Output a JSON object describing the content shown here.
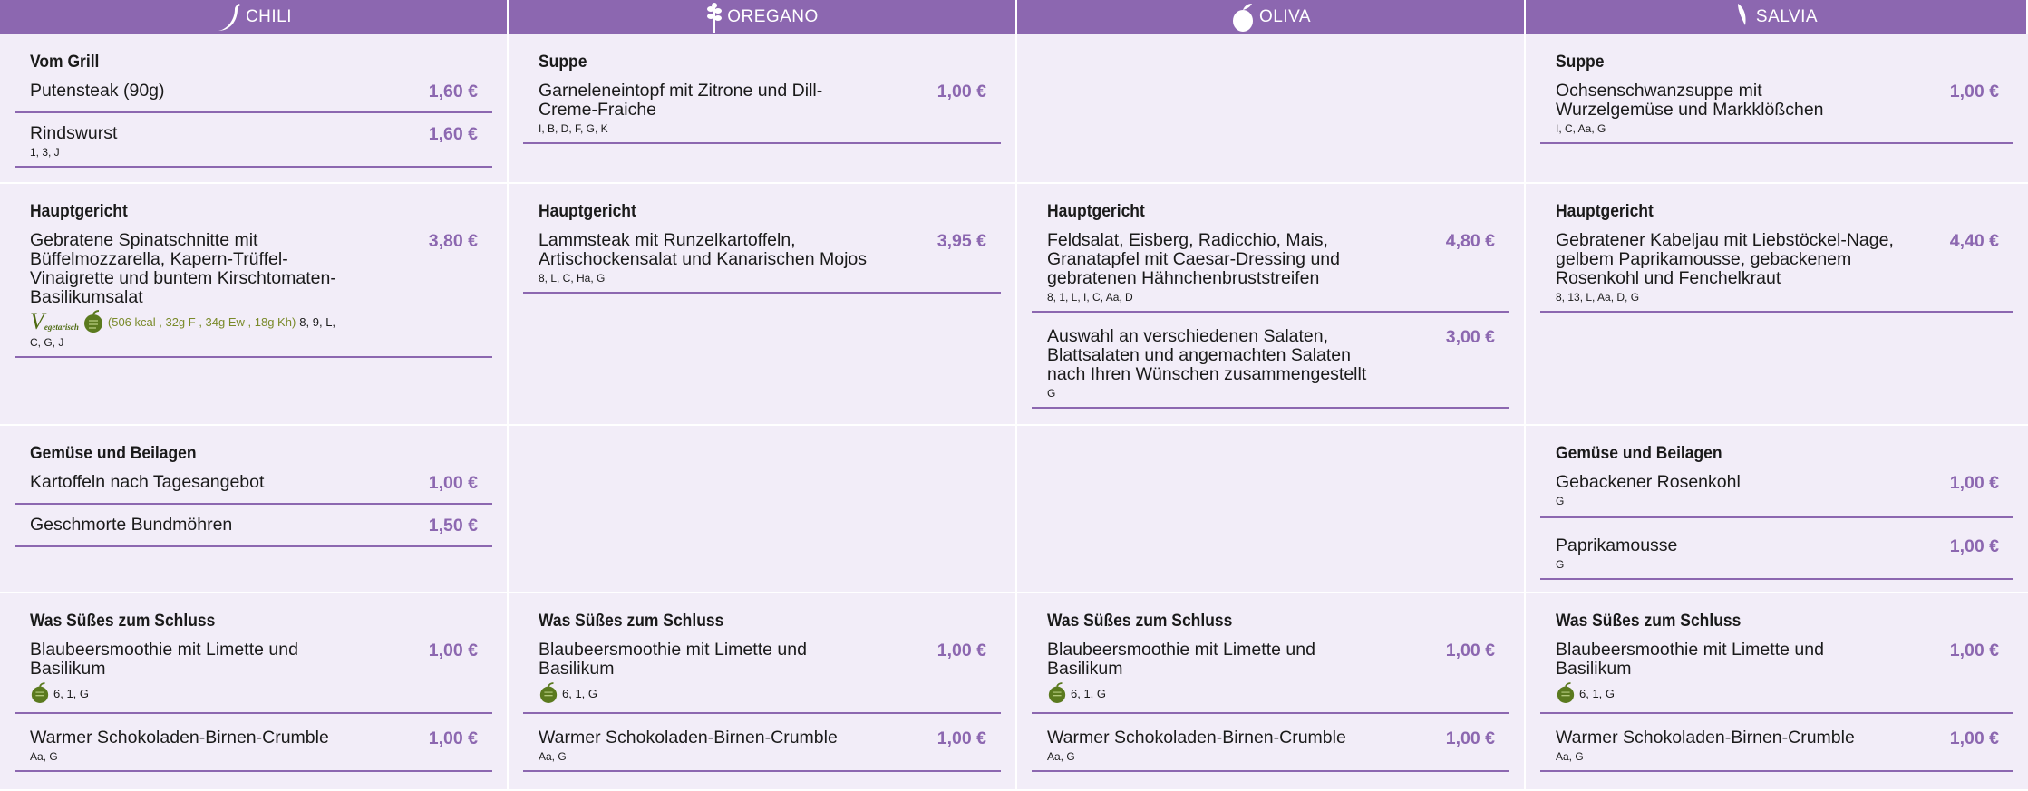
{
  "columns": [
    {
      "name": "CHILI",
      "icon": "chili-icon"
    },
    {
      "name": "OREGANO",
      "icon": "oregano-icon"
    },
    {
      "name": "OLIVA",
      "icon": "olive-icon"
    },
    {
      "name": "SALVIA",
      "icon": "sage-icon"
    }
  ],
  "colors": {
    "accent": "#8c67b0",
    "cell_bg": "#f2edf8",
    "price": "#8c67b0",
    "veg_green": "#4e6b12",
    "nutri": "#7a8a2a"
  },
  "rows": {
    "r1": {
      "chili": {
        "title": "Vom Grill",
        "items": [
          {
            "name": "Putensteak (90g)",
            "price": "1,60 €",
            "allergens": ""
          },
          {
            "name": "Rindswurst",
            "price": "1,60 €",
            "allergens": "1, 3, J"
          }
        ]
      },
      "oregano": {
        "title": "Suppe",
        "items": [
          {
            "name": "Garneleneintopf mit Zitrone und Dill-Creme-Fraiche",
            "price": "1,00 €",
            "allergens": "I, B, D, F, G, K"
          }
        ]
      },
      "salvia": {
        "title": "Suppe",
        "items": [
          {
            "name": "Ochsenschwanzsuppe mit Wurzelgemüse und Markklößchen",
            "price": "1,00 €",
            "allergens": "I, C, Aa, G"
          }
        ]
      }
    },
    "r2": {
      "chili": {
        "title": "Hauptgericht",
        "items": [
          {
            "name": "Gebratene Spinatschnitte mit Büffelmozzarella, Kapern-Trüffel-Vinaigrette und buntem Kirschtomaten-Basilikumsalat",
            "price": "3,80 €",
            "veg_big": "V",
            "veg_text": "egetarisch",
            "nutrition": "(506 kcal , 32g F , 34g Ew , 18g Kh)",
            "allergens_inline": "8, 9, L,",
            "allergens": "C, G, J"
          }
        ]
      },
      "oregano": {
        "title": "Hauptgericht",
        "items": [
          {
            "name": "Lammsteak mit Runzelkartoffeln, Artischockensalat und Kanarischen Mojos",
            "price": "3,95 €",
            "allergens": "8, L, C, Ha, G"
          }
        ]
      },
      "oliva": {
        "title": "Hauptgericht",
        "items": [
          {
            "name": "Feldsalat, Eisberg, Radicchio, Mais, Granatapfel mit Caesar-Dressing und gebratenen Hähnchenbruststreifen",
            "price": "4,80 €",
            "allergens": "8, 1, L, I, C, Aa, D"
          },
          {
            "name": "Auswahl an verschiedenen Salaten, Blattsalaten und angemachten Salaten nach Ihren Wünschen zusammengestellt",
            "price": "3,00 €",
            "allergens": "G"
          }
        ]
      },
      "salvia": {
        "title": "Hauptgericht",
        "items": [
          {
            "name": "Gebratener Kabeljau mit Liebstöckel-Nage, gelbem Paprikamousse, gebackenem Rosenkohl und Fenchelkraut",
            "price": "4,40 €",
            "allergens": "8, 13, L, Aa, D, G"
          }
        ]
      }
    },
    "r3": {
      "chili": {
        "title": "Gemüse und Beilagen",
        "items": [
          {
            "name": "Kartoffeln nach Tagesangebot",
            "price": "1,00 €",
            "allergens": ""
          },
          {
            "name": "Geschmorte Bundmöhren",
            "price": "1,50 €",
            "allergens": ""
          }
        ]
      },
      "salvia": {
        "title": "Gemüse und Beilagen",
        "items": [
          {
            "name": "Gebackener Rosenkohl",
            "price": "1,00 €",
            "allergens": "G"
          },
          {
            "name": "Paprikamousse",
            "price": "1,00 €",
            "allergens": "G"
          }
        ]
      }
    },
    "r4": {
      "title": "Was Süßes zum Schluss",
      "items": [
        {
          "name": "Blaubeersmoothie mit Limette und Basilikum",
          "price": "1,00 €",
          "allergens": "6, 1, G"
        },
        {
          "name": "Warmer Schokoladen-Birnen-Crumble",
          "price": "1,00 €",
          "allergens": "Aa, G"
        }
      ]
    }
  }
}
